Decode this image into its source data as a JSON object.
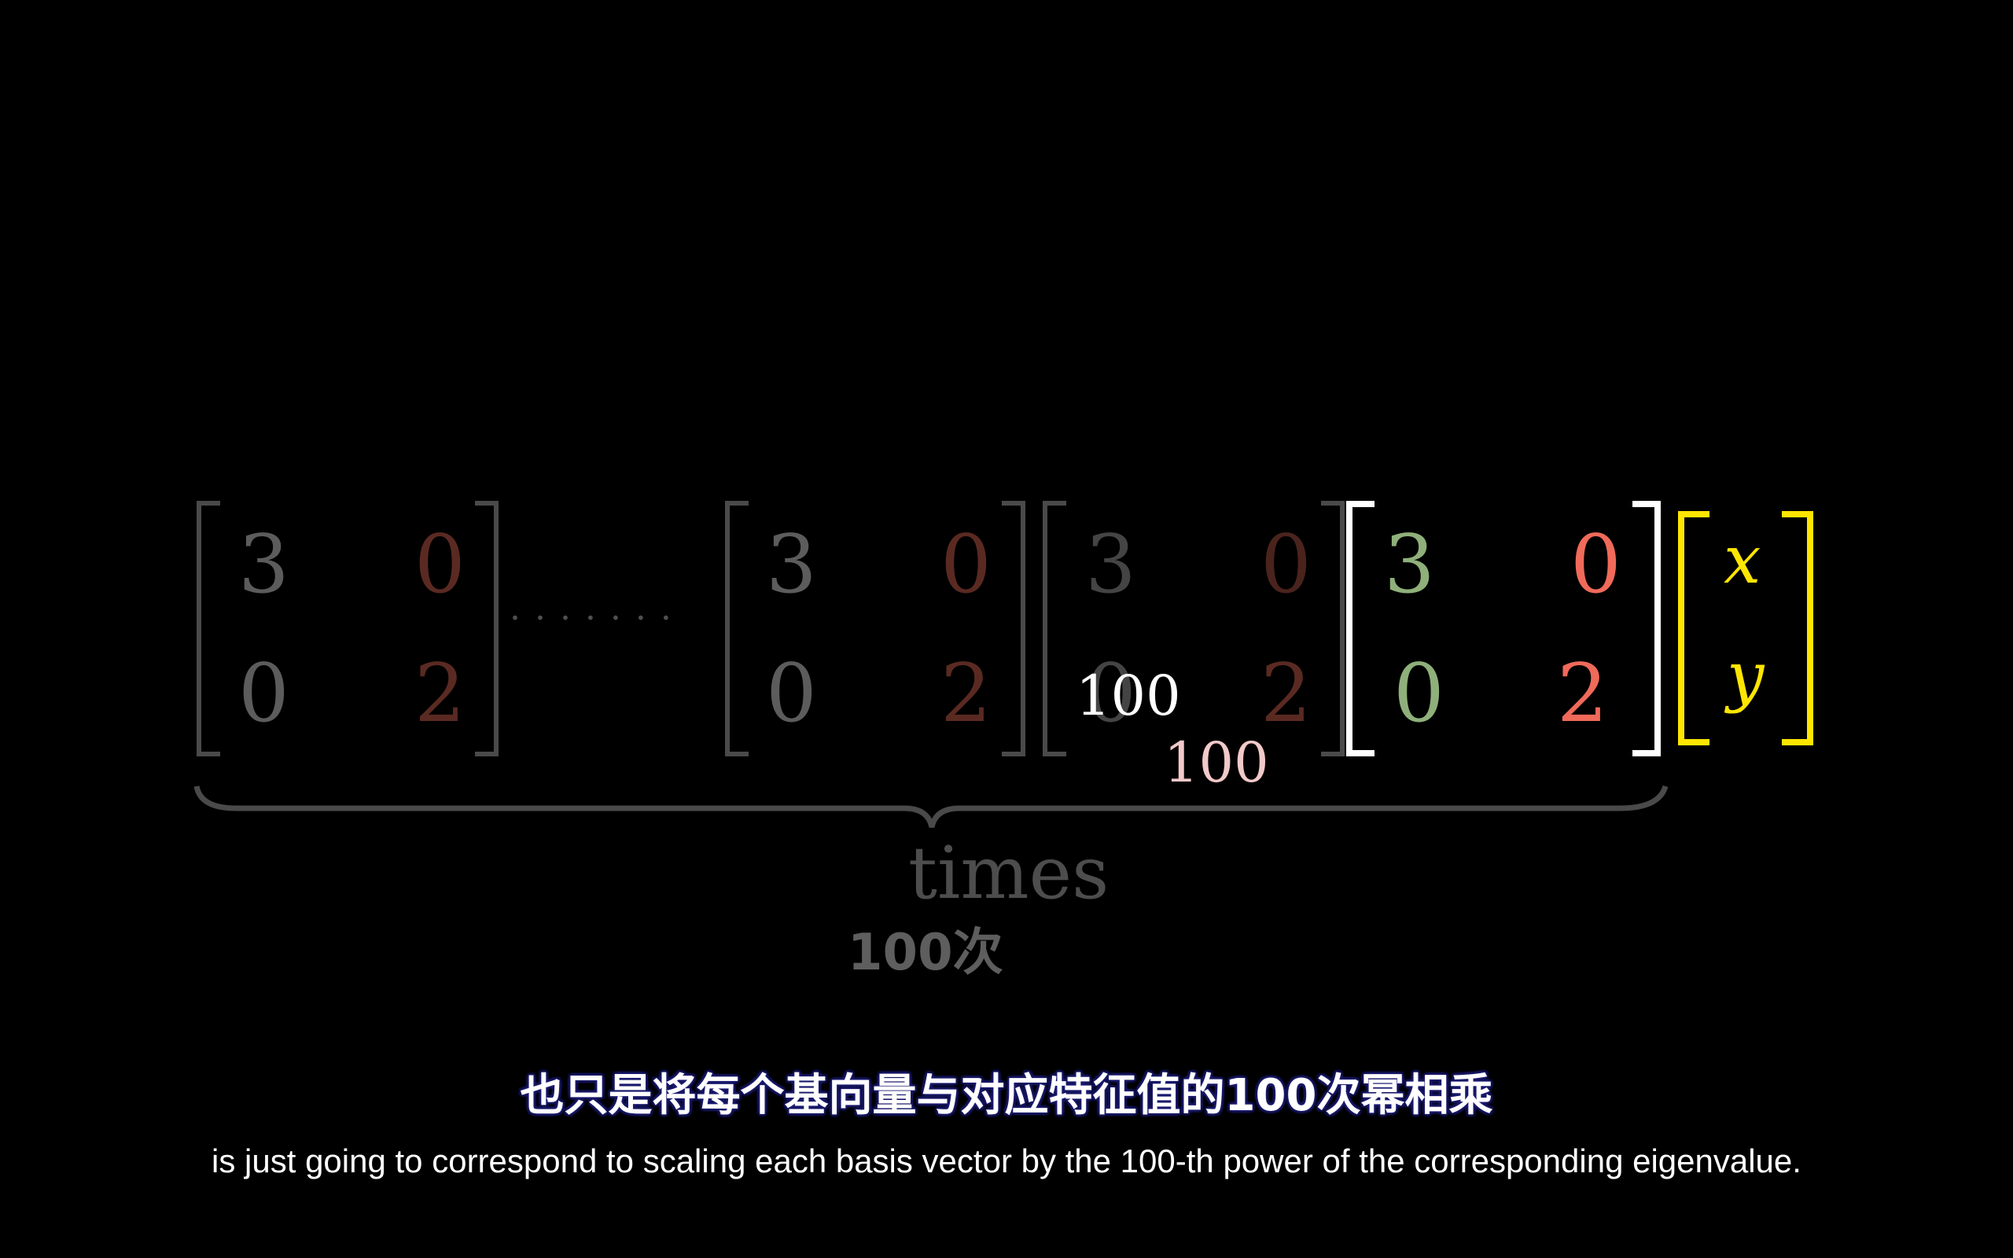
{
  "colors": {
    "background": "#000000",
    "dim_grey": "#5c5c5c",
    "dim_red": "#5a2a22",
    "bright_bracket": "#ffffff",
    "green": "#8fb07a",
    "red": "#f06a5a",
    "yellow": "#ffe600",
    "pink_label": "#f2c9c9",
    "times_label": "#4d4d4d",
    "cn_label": "#5e5e5e",
    "subtitle_outline": "#1a1a6e"
  },
  "matrices": {
    "m1": {
      "a": "3",
      "b": "0",
      "c": "0",
      "d": "2"
    },
    "m2": {
      "a": "3",
      "b": "0",
      "c": "0",
      "d": "2"
    },
    "m3": {
      "a": "3",
      "b": "0",
      "c": "0",
      "d": "2"
    },
    "m4": {
      "a": "3",
      "b": "0",
      "c": "0",
      "d": "2"
    }
  },
  "ellipsis": ". . . . . . .",
  "vector": {
    "x": "x",
    "y": "y"
  },
  "labels": {
    "hundred_white": "100",
    "hundred_pink": "100",
    "times": "times",
    "times_cn": "100次"
  },
  "subtitles": {
    "chinese": "也只是将每个基向量与对应特征值的100次幂相乘",
    "english": "is just going to correspond to scaling each basis vector by the 100-th power of the corresponding eigenvalue."
  }
}
